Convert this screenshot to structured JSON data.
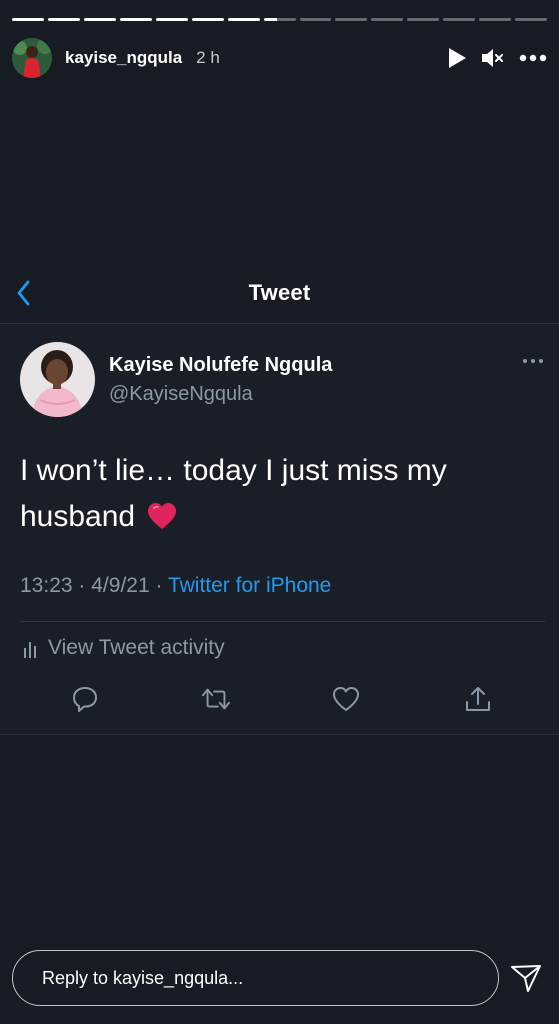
{
  "story": {
    "progress": {
      "segments": 15,
      "completed": 7,
      "current_fraction": 0.4
    },
    "username": "kayise_ngqula",
    "time_ago": "2 h",
    "icons": [
      "play-icon",
      "mute-icon",
      "more-options-icon"
    ]
  },
  "tweet": {
    "nav_title": "Tweet",
    "author_name": "Kayise Nolufefe Ngqula",
    "author_handle": "@KayiseNgqula",
    "text": "I won’t lie… today I just miss my husband",
    "emoji_icon": "red-heart-emoji",
    "time": "13:23",
    "date": "4/9/21",
    "separator": "·",
    "source": "Twitter for iPhone",
    "activity_label": "View Tweet activity",
    "actions": [
      "reply-icon",
      "retweet-icon",
      "like-icon",
      "share-icon"
    ]
  },
  "reply": {
    "placeholder": "Reply to kayise_ngqula..."
  },
  "colors": {
    "background": "#161b24",
    "card": "#1a1f27",
    "link": "#1d9bf0",
    "muted": "#8b98a5",
    "heart": "#e0245e"
  }
}
